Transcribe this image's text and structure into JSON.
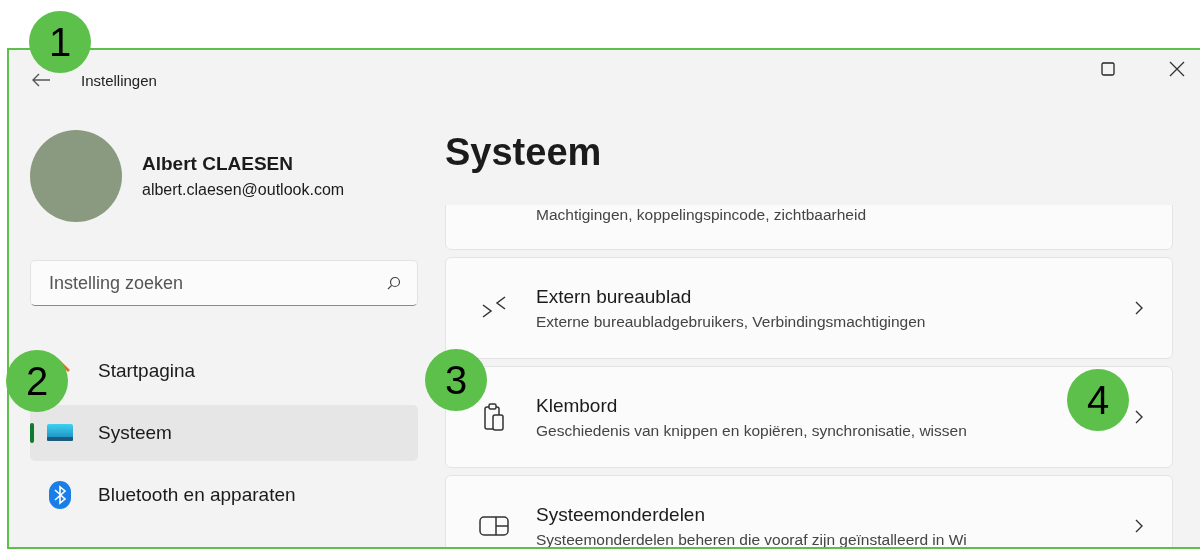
{
  "window": {
    "title": "Instellingen"
  },
  "profile": {
    "name": "Albert CLAESEN",
    "email": "albert.claesen@outlook.com"
  },
  "search": {
    "placeholder": "Instelling zoeken"
  },
  "nav": [
    {
      "label": "Startpagina",
      "kind": "home",
      "selected": false
    },
    {
      "label": "Systeem",
      "kind": "system",
      "selected": true
    },
    {
      "label": "Bluetooth en apparaten",
      "kind": "bluetooth",
      "selected": false
    }
  ],
  "page_title": "Systeem",
  "cards": [
    {
      "kind": "dash",
      "description": "Machtigingen, koppelingspincode, zichtbaarheid"
    },
    {
      "kind": "remote",
      "title": "Extern bureaublad",
      "description": "Externe bureaubladgebruikers, Verbindingsmachtigingen"
    },
    {
      "kind": "clipboard",
      "title": "Klembord",
      "description": "Geschiedenis van knippen en kopiëren, synchronisatie, wissen"
    },
    {
      "kind": "components",
      "title": "Systeemonderdelen",
      "description": "Systeemonderdelen beheren die vooraf zijn geïnstalleerd in Wi"
    }
  ],
  "callouts": [
    "1",
    "2",
    "3",
    "4"
  ]
}
